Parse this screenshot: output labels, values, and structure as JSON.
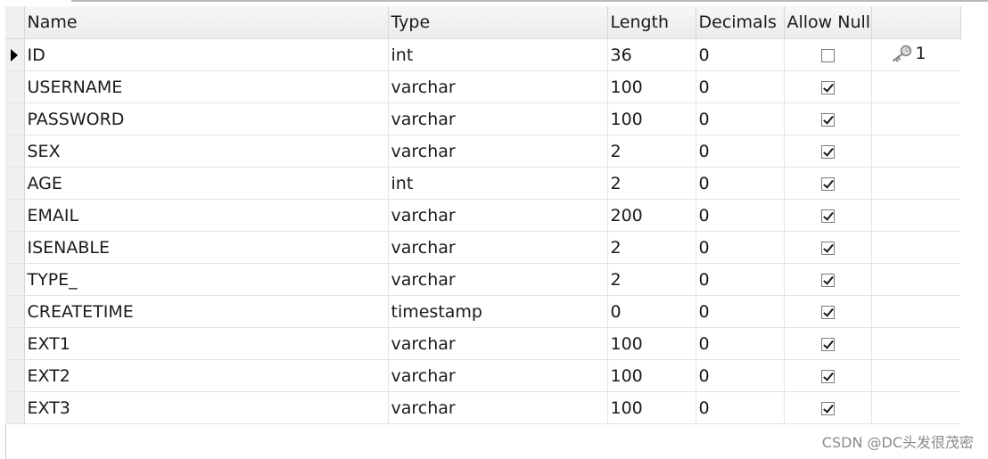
{
  "columns": {
    "name": "Name",
    "type": "Type",
    "length": "Length",
    "decimals": "Decimals",
    "allow_null": "Allow Null"
  },
  "rows": [
    {
      "name": "ID",
      "type": "int",
      "length": "36",
      "decimals": "0",
      "allow_null": false,
      "key": "1",
      "current": true
    },
    {
      "name": "USERNAME",
      "type": "varchar",
      "length": "100",
      "decimals": "0",
      "allow_null": true
    },
    {
      "name": "PASSWORD",
      "type": "varchar",
      "length": "100",
      "decimals": "0",
      "allow_null": true
    },
    {
      "name": "SEX",
      "type": "varchar",
      "length": "2",
      "decimals": "0",
      "allow_null": true
    },
    {
      "name": "AGE",
      "type": "int",
      "length": "2",
      "decimals": "0",
      "allow_null": true
    },
    {
      "name": "EMAIL",
      "type": "varchar",
      "length": "200",
      "decimals": "0",
      "allow_null": true
    },
    {
      "name": "ISENABLE",
      "type": "varchar",
      "length": "2",
      "decimals": "0",
      "allow_null": true
    },
    {
      "name": "TYPE_",
      "type": "varchar",
      "length": "2",
      "decimals": "0",
      "allow_null": true
    },
    {
      "name": "CREATETIME",
      "type": "timestamp",
      "length": "0",
      "decimals": "0",
      "allow_null": true
    },
    {
      "name": "EXT1",
      "type": "varchar",
      "length": "100",
      "decimals": "0",
      "allow_null": true
    },
    {
      "name": "EXT2",
      "type": "varchar",
      "length": "100",
      "decimals": "0",
      "allow_null": true
    },
    {
      "name": "EXT3",
      "type": "varchar",
      "length": "100",
      "decimals": "0",
      "allow_null": true
    }
  ],
  "icons": {
    "row_pointer": "row-pointer-icon",
    "primary_key": "key-icon"
  },
  "watermark": "CSDN @DC头发很茂密"
}
